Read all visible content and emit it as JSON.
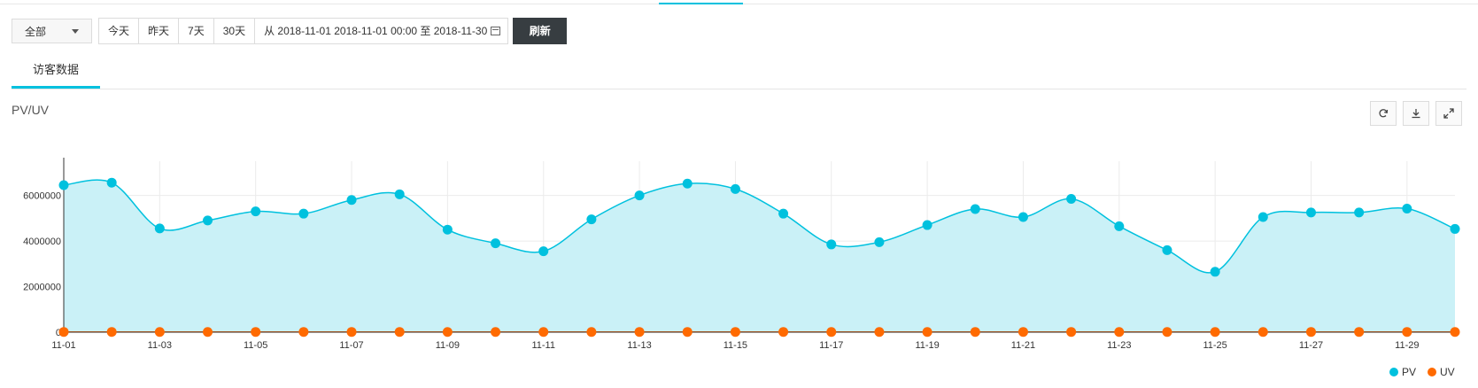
{
  "filter": {
    "select_value": "全部",
    "quick_ranges": [
      "今天",
      "昨天",
      "7天",
      "30天"
    ],
    "date_range": "从 2018-11-01 2018-11-01 00:00 至 2018-11-30",
    "refresh_label": "刷新"
  },
  "tabs": [
    {
      "label": "访客数据"
    }
  ],
  "chart_title": "PV/UV",
  "toolbar_icons": [
    "refresh-icon",
    "download-icon",
    "fullscreen-icon"
  ],
  "colors": {
    "accent": "#00c1de",
    "pv": "#00c1de",
    "pv_area": "#caf1f7",
    "uv": "#ff6a00",
    "button_dark": "#373d41"
  },
  "chart_data": {
    "type": "area",
    "x": [
      "11-01",
      "11-02",
      "11-03",
      "11-04",
      "11-05",
      "11-06",
      "11-07",
      "11-08",
      "11-09",
      "11-10",
      "11-11",
      "11-12",
      "11-13",
      "11-14",
      "11-15",
      "11-16",
      "11-17",
      "11-18",
      "11-19",
      "11-20",
      "11-21",
      "11-22",
      "11-23",
      "11-24",
      "11-25",
      "11-26",
      "11-27",
      "11-28",
      "11-29",
      "11-30"
    ],
    "x_tick_labels": [
      "11-01",
      "11-03",
      "11-05",
      "11-07",
      "11-09",
      "11-11",
      "11-13",
      "11-15",
      "11-17",
      "11-19",
      "11-21",
      "11-23",
      "11-25",
      "11-27",
      "11-29"
    ],
    "series": [
      {
        "name": "PV",
        "color": "#00c1de",
        "values": [
          6450000,
          6560000,
          4550000,
          4900000,
          5300000,
          5200000,
          5800000,
          6050000,
          4500000,
          3900000,
          3550000,
          4950000,
          6000000,
          6520000,
          6280000,
          5200000,
          3850000,
          3950000,
          4700000,
          5400000,
          5050000,
          5850000,
          4650000,
          3600000,
          2650000,
          5050000,
          5250000,
          5250000,
          5420000,
          4530000
        ]
      },
      {
        "name": "UV",
        "color": "#ff6a00",
        "values": [
          12000,
          12000,
          11000,
          11000,
          12000,
          12000,
          12000,
          12000,
          11000,
          11000,
          10000,
          11000,
          12000,
          12000,
          12000,
          12000,
          11000,
          11000,
          11000,
          12000,
          12000,
          12000,
          11000,
          10000,
          9000,
          11000,
          12000,
          12000,
          12000,
          11000
        ]
      }
    ],
    "y_ticks": [
      "0",
      "2000000",
      "4000000",
      "6000000"
    ],
    "ylim": [
      0,
      7500000
    ],
    "grid": true,
    "legend": "bottom-right"
  }
}
